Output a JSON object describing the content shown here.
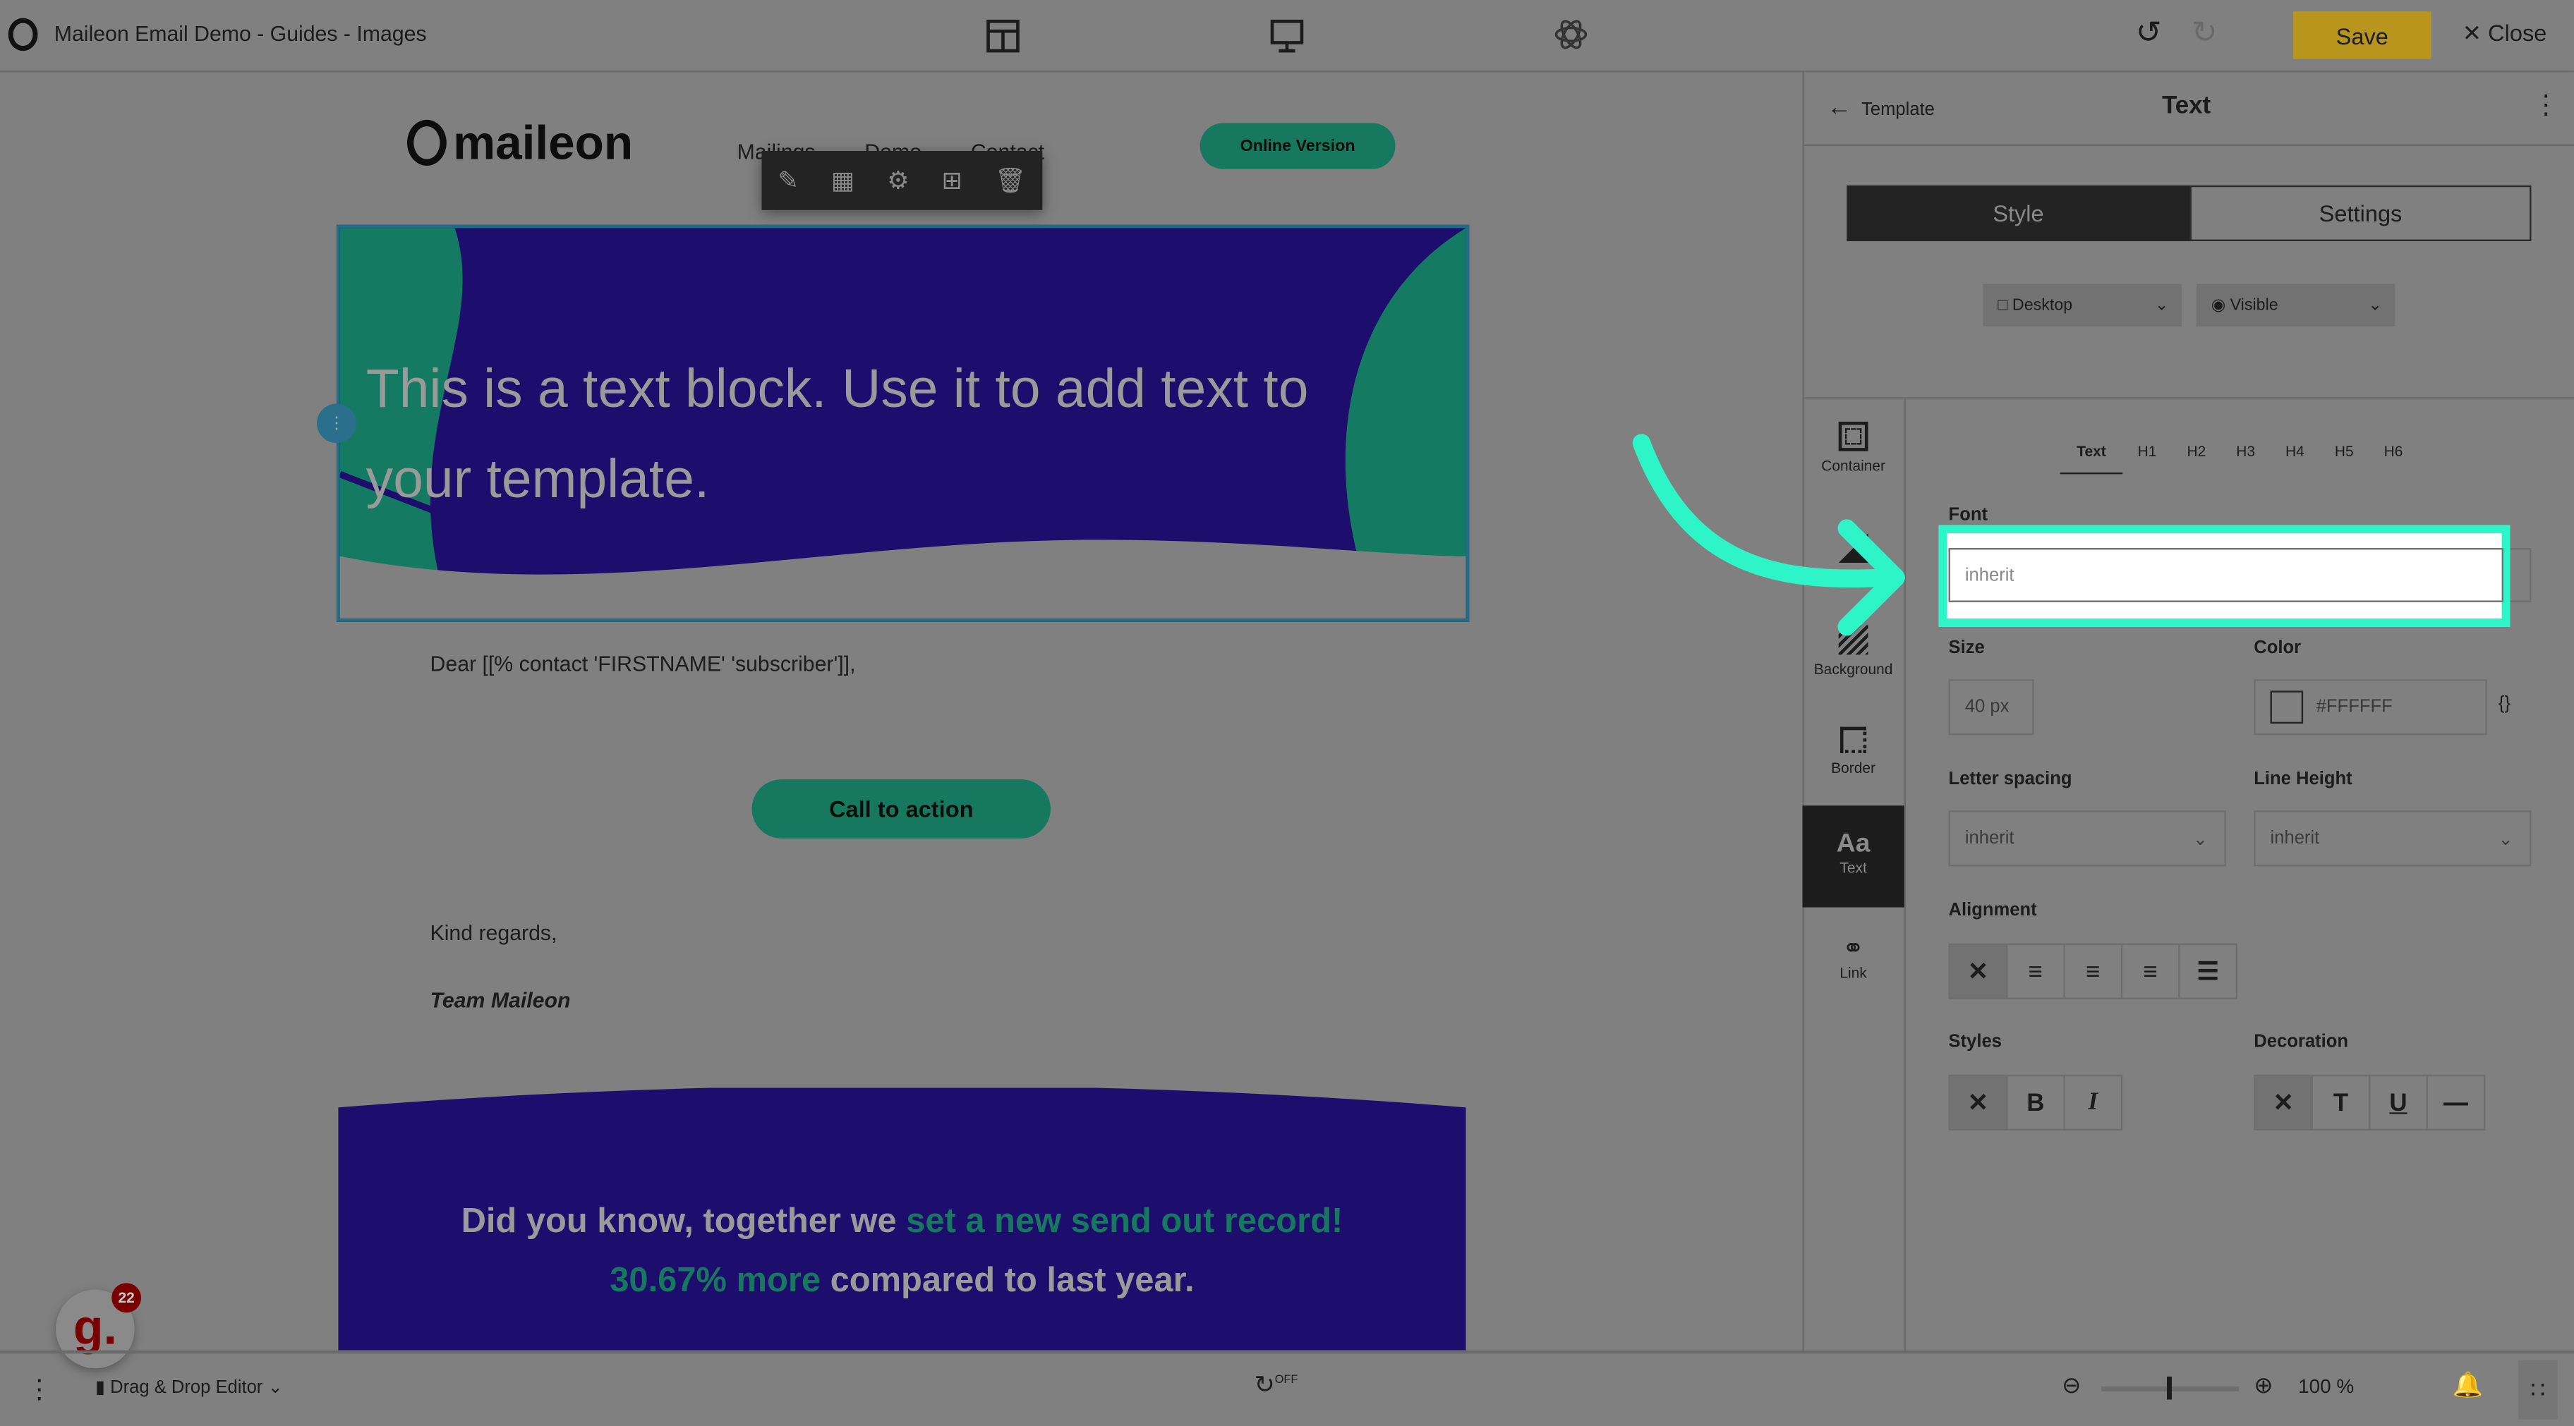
{
  "header": {
    "title": "Maileon Email Demo - Guides - Images",
    "save": "Save",
    "close": "Close",
    "icons": [
      "layout-icon",
      "desktop-icon",
      "atom-icon",
      "undo-icon",
      "redo-icon"
    ]
  },
  "email": {
    "logo": "maileon",
    "nav": [
      "Mailings",
      "Demo",
      "Contact"
    ],
    "online_version": "Online Version",
    "hero_text": "This is a text block. Use it to add text to your template.",
    "greeting": "Dear [[% contact 'FIRSTNAME' 'subscriber']],",
    "cta": "Call to action",
    "regards": "Kind regards,",
    "signature": "Team Maileon",
    "fact_1": "Did you know, together we ",
    "fact_hl": "set a new send out record! 30.67% more",
    "fact_2": " compared to last year."
  },
  "panel": {
    "back": "Template",
    "title": "Text",
    "tabs": [
      "Style",
      "Settings"
    ],
    "device": "Desktop",
    "visibility": "Visible",
    "side": [
      "Container",
      "",
      "Background",
      "Border",
      "Text",
      "Link"
    ],
    "levels": [
      "Text",
      "H1",
      "H2",
      "H3",
      "H4",
      "H5",
      "H6"
    ],
    "font_label": "Font",
    "font_value": "inherit",
    "size_label": "Size",
    "size_value": "40 px",
    "color_label": "Color",
    "color_value": "#FFFFFF",
    "ls_label": "Letter spacing",
    "ls_value": "inherit",
    "lh_label": "Line Height",
    "lh_value": "inherit",
    "align_label": "Alignment",
    "styles_label": "Styles",
    "decoration_label": "Decoration"
  },
  "footer": {
    "editor": "Drag & Drop Editor",
    "autosave": "OFF",
    "zoom": "100 %",
    "zoom_level": 100,
    "badge_count": "22"
  },
  "colors": {
    "highlight": "#2EF5C8",
    "banner": "#1D0D6D",
    "accent": "#16785F",
    "save": "#B8961E"
  }
}
